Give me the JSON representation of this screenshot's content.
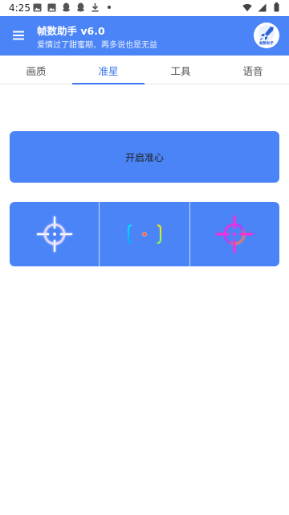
{
  "status_bar": {
    "time": "4:25",
    "left_icons": [
      "image-icon",
      "image-icon",
      "qq-icon",
      "qq-icon",
      "download-icon",
      "dot-icon"
    ],
    "right_icons": [
      "wifi-icon",
      "signal-icon",
      "battery-icon"
    ]
  },
  "app_bar": {
    "title": "帧数助手 v6.0",
    "subtitle": "爱情过了甜蜜期、再多说也是无益",
    "logo_text": "帧数助手",
    "background_color": "#4b84f7"
  },
  "tabs": [
    {
      "label": "画质",
      "active": false
    },
    {
      "label": "准星",
      "active": true
    },
    {
      "label": "工具",
      "active": false
    },
    {
      "label": "语音",
      "active": false
    }
  ],
  "main": {
    "enable_button_label": "开启准心",
    "reticles": [
      {
        "name": "white-crosshair",
        "color": "#ffffff"
      },
      {
        "name": "bracket-reticle",
        "color": "#ff5a3c"
      },
      {
        "name": "gradient-crosshair",
        "color": "#ff2bd6"
      }
    ]
  }
}
